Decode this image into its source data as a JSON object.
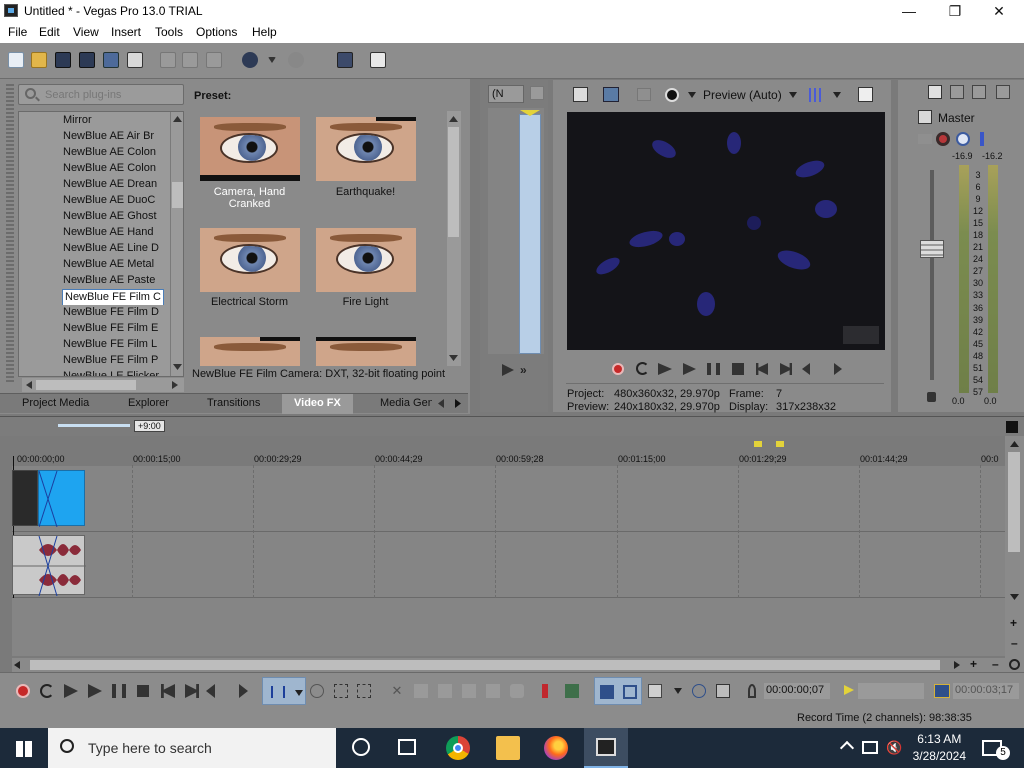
{
  "window": {
    "title": "Untitled * - Vegas Pro 13.0 TRIAL"
  },
  "menu": [
    "File",
    "Edit",
    "View",
    "Insert",
    "Tools",
    "Options",
    "Help"
  ],
  "plugins": {
    "search_placeholder": "Search plug-ins",
    "preset_label": "Preset:",
    "items": [
      "Mirror",
      "NewBlue AE Air Br",
      "NewBlue AE Colon",
      "NewBlue AE Colon",
      "NewBlue AE Drean",
      "NewBlue AE DuoC",
      "NewBlue AE Ghost",
      "NewBlue AE Hand",
      "NewBlue AE Line D",
      "NewBlue AE Metal",
      "NewBlue AE Paste",
      "NewBlue FE Film C",
      "NewBlue FE Film D",
      "NewBlue FE Film E",
      "NewBlue FE Film L",
      "NewBlue FE Film P",
      "NewBlue LE Flicker"
    ],
    "selected_index": 11,
    "presets": [
      "Camera, Hand Cranked",
      "Earthquake!",
      "Electrical Storm",
      "Fire Light"
    ],
    "status": "NewBlue FE Film Camera: DXT, 32-bit floating point"
  },
  "tabs": [
    "Project Media",
    "Explorer",
    "Transitions",
    "Video FX",
    "Media Gene"
  ],
  "active_tab": "Video FX",
  "trimmer": {
    "dropdown": "(N"
  },
  "preview": {
    "mode": "Preview (Auto)",
    "project_label": "Project:",
    "project_value": "480x360x32, 29.970p",
    "preview_label": "Preview:",
    "preview_value": "240x180x32, 29.970p",
    "frame_label": "Frame:",
    "frame_value": "7",
    "display_label": "Display:",
    "display_value": "317x238x32"
  },
  "mixer": {
    "title": "Master",
    "left_peak": "-16.9",
    "right_peak": "-16.2",
    "scale": [
      "3",
      "6",
      "9",
      "12",
      "15",
      "18",
      "21",
      "24",
      "27",
      "30",
      "33",
      "36",
      "39",
      "42",
      "45",
      "48",
      "51",
      "54",
      "57"
    ],
    "left_bottom": "0.0",
    "right_bottom": "0.0"
  },
  "timeline": {
    "offset_badge": "+9:00",
    "ticks": [
      "00:00:00;00",
      "00:00:15;00",
      "00:00:29;29",
      "00:00:44;29",
      "00:00:59;28",
      "00:01:15;00",
      "00:01:29;29",
      "00:01:44;29",
      "00:0"
    ]
  },
  "transport": {
    "time": "00:00:00;07",
    "end_time": "00:00:03;17",
    "record_time": "Record Time (2 channels): 98:38:35"
  },
  "taskbar": {
    "search_placeholder": "Type here to search",
    "time": "6:13 AM",
    "date": "3/28/2024",
    "notifications": "5"
  }
}
